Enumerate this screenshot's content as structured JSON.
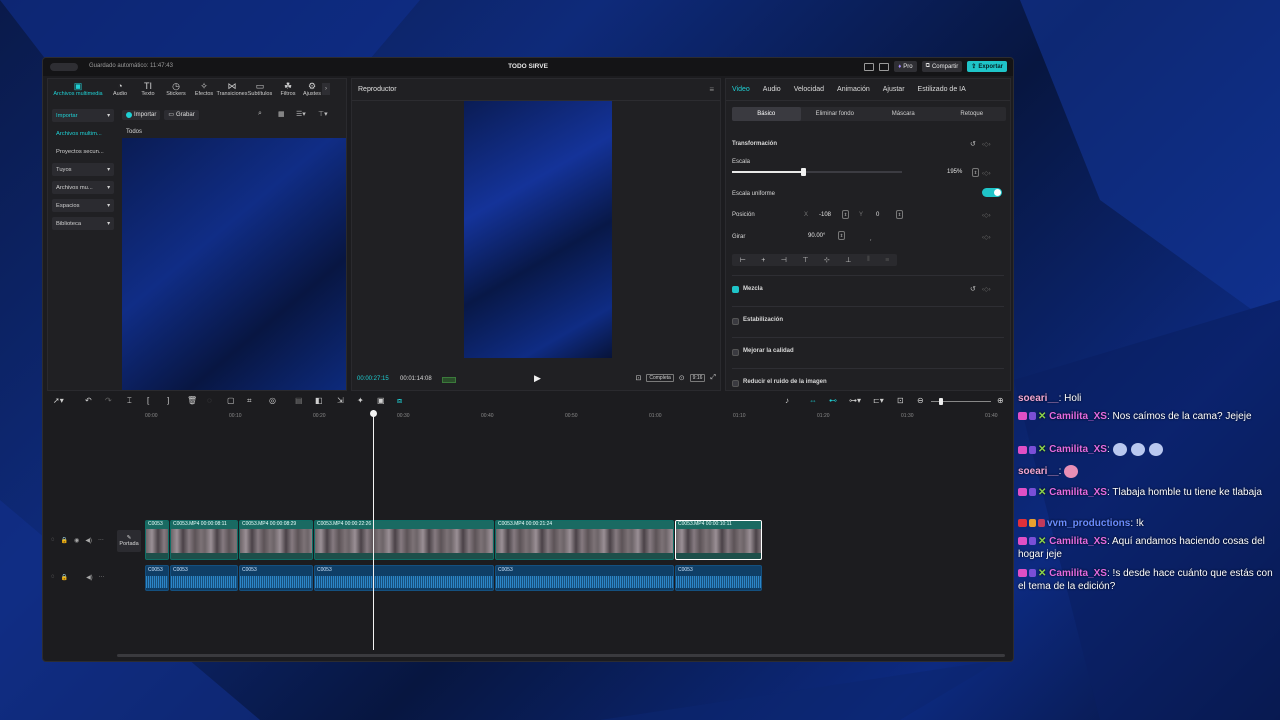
{
  "app": {
    "autosave_text": "Guardado automático: 11:47:43",
    "title": "TODO SIRVE",
    "pro_label": "Pro",
    "share_label": "Compartir",
    "export_label": "Exportar"
  },
  "media": {
    "tools": [
      {
        "label": "Archivos multimedia",
        "icon": "media-icon"
      },
      {
        "label": "Audio",
        "icon": "audio-icon"
      },
      {
        "label": "Texto",
        "icon": "text-icon"
      },
      {
        "label": "Stickers",
        "icon": "sticker-icon"
      },
      {
        "label": "Efectos",
        "icon": "effects-icon"
      },
      {
        "label": "Transiciones",
        "icon": "transitions-icon"
      },
      {
        "label": "Subtítulos",
        "icon": "subtitles-icon"
      },
      {
        "label": "Filtros",
        "icon": "filters-icon"
      },
      {
        "label": "Ajustes",
        "icon": "adjust-icon"
      }
    ],
    "sidebar": [
      {
        "label": "Importar"
      },
      {
        "label": "Archivos multim..."
      },
      {
        "label": "Proyectos secun..."
      },
      {
        "label": "Tuyos"
      },
      {
        "label": "Archivos mu..."
      },
      {
        "label": "Espacios"
      },
      {
        "label": "Biblioteca"
      }
    ],
    "import_label": "Importar",
    "record_label": "Grabar",
    "all_label": "Todos"
  },
  "player": {
    "title": "Reproductor",
    "current_time": "00:00:27:15",
    "duration": "00:01:14:08",
    "fit_label": "Completa",
    "ratio_label": "9:16"
  },
  "props": {
    "tabs": [
      "Video",
      "Audio",
      "Velocidad",
      "Animación",
      "Ajustar",
      "Estilizado de IA"
    ],
    "subtabs": [
      "Básico",
      "Eliminar fondo",
      "Máscara",
      "Retoque"
    ],
    "transform_label": "Transformación",
    "scale_label": "Escala",
    "scale_value": "195%",
    "scale_fraction": 0.42,
    "uniform_label": "Escala uniforme",
    "position_label": "Posición",
    "x_label": "X",
    "x_value": "-108",
    "y_label": "Y",
    "y_value": "0",
    "rotate_label": "Girar",
    "rotate_value": "90.00°",
    "blend_label": "Mezcla",
    "stabilize_label": "Estabilización",
    "quality_label": "Mejorar la calidad",
    "noise_label": "Reducir el ruido de la imagen"
  },
  "timeline": {
    "ruler": [
      "00:00",
      "00:10",
      "00:20",
      "00:30",
      "00:40",
      "00:50",
      "01:00",
      "01:10",
      "01:20",
      "01:30",
      "01:40"
    ],
    "cover_label": "Portada",
    "video_clips": [
      {
        "label": "C0053"
      },
      {
        "label": "C0053.MP4   00:00:08:11"
      },
      {
        "label": "C0053.MP4   00:00:08:29"
      },
      {
        "label": "C0053.MP4   00:00:22:26"
      },
      {
        "label": "C0053.MP4   00:00:21:24"
      },
      {
        "label": "C0053.MP4   00:00:10:11"
      }
    ],
    "audio_clips": [
      {
        "label": "C0053"
      },
      {
        "label": "C0053"
      },
      {
        "label": "C0053"
      },
      {
        "label": "C0053"
      },
      {
        "label": "C0053"
      },
      {
        "label": "C0053"
      }
    ]
  },
  "chat": [
    {
      "user": "soeari__",
      "text": "Holi",
      "color": "#f0a6d0"
    },
    {
      "user": "Camilita_XS",
      "text": "Nos caímos de la cama? Jejeje",
      "color": "#e46be0"
    },
    {
      "user": "Camilita_XS",
      "text": "",
      "color": "#e46be0"
    },
    {
      "user": "soeari__",
      "text": "",
      "color": "#f0a6d0"
    },
    {
      "user": "Camilita_XS",
      "text": "Tlabaja homble tu tiene ke tlabaja",
      "color": "#e46be0"
    },
    {
      "user": "vvm_productions",
      "text": "!k",
      "color": "#6a8cff"
    },
    {
      "user": "Camilita_XS",
      "text": "Aquí andamos haciendo cosas del hogar jeje",
      "color": "#e46be0"
    },
    {
      "user": "Camilita_XS",
      "text": "!s desde hace cuánto que estás con el tema de la edición?",
      "color": "#e46be0"
    }
  ]
}
